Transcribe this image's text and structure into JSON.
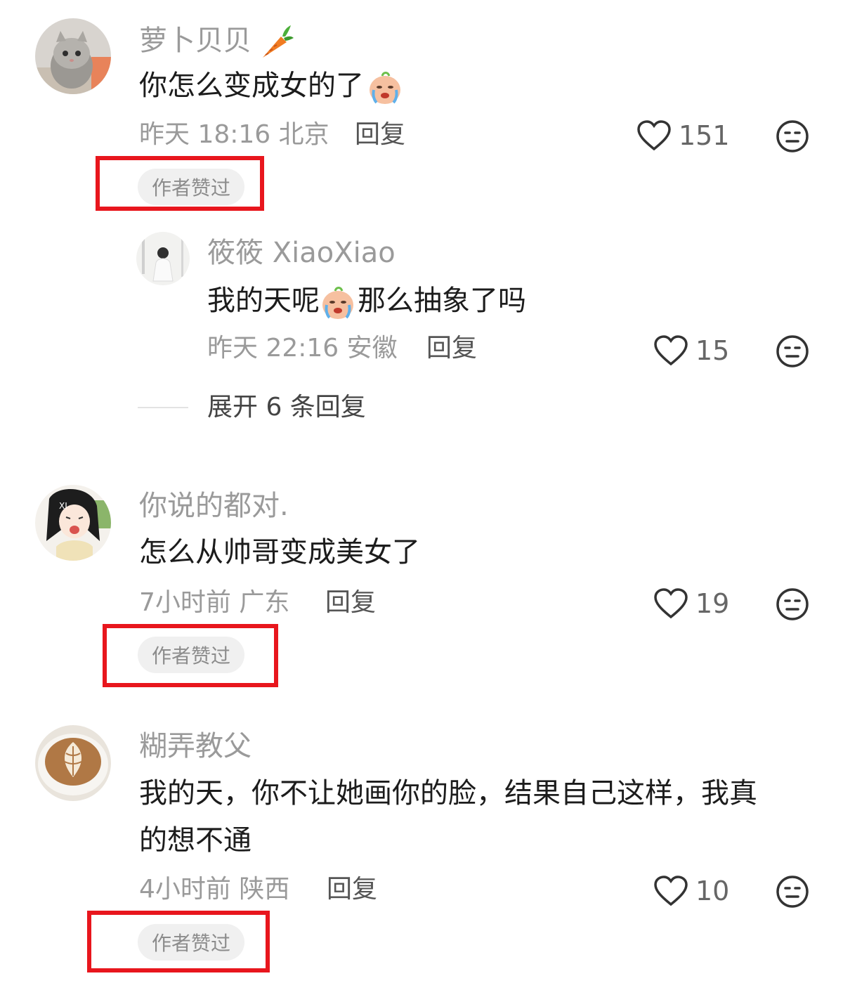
{
  "comments": [
    {
      "username": "萝卜贝贝",
      "username_icon": "carrot-icon",
      "text": "你怎么变成女的了",
      "emoji": "crying-face-emoji",
      "time_location": "昨天 18:16 北京",
      "reply_label": "回复",
      "likes": "151",
      "badge": "作者赞过",
      "reply": {
        "username": "筱筱 XiaoXiao",
        "text_before": "我的天呢",
        "emoji": "crying-face-emoji",
        "text_after": "那么抽象了吗",
        "time_location": "昨天 22:16 安徽",
        "reply_label": "回复",
        "likes": "15"
      },
      "expand_label": "展开 6 条回复"
    },
    {
      "username": "你说的都对.",
      "text": "怎么从帅哥变成美女了",
      "time_location": "7小时前 广东",
      "reply_label": "回复",
      "likes": "19",
      "badge": "作者赞过"
    },
    {
      "username": "糊弄教父",
      "text_line1": "我的天，你不让她画你的脸，结果自己这样，我真",
      "text_line2": "的想不通",
      "time_location": "4小时前 陕西",
      "reply_label": "回复",
      "likes": "10",
      "badge": "作者赞过"
    }
  ],
  "colors": {
    "highlight_box": "#e8161d",
    "username": "#9a9a9a",
    "text": "#1c1c1c"
  }
}
